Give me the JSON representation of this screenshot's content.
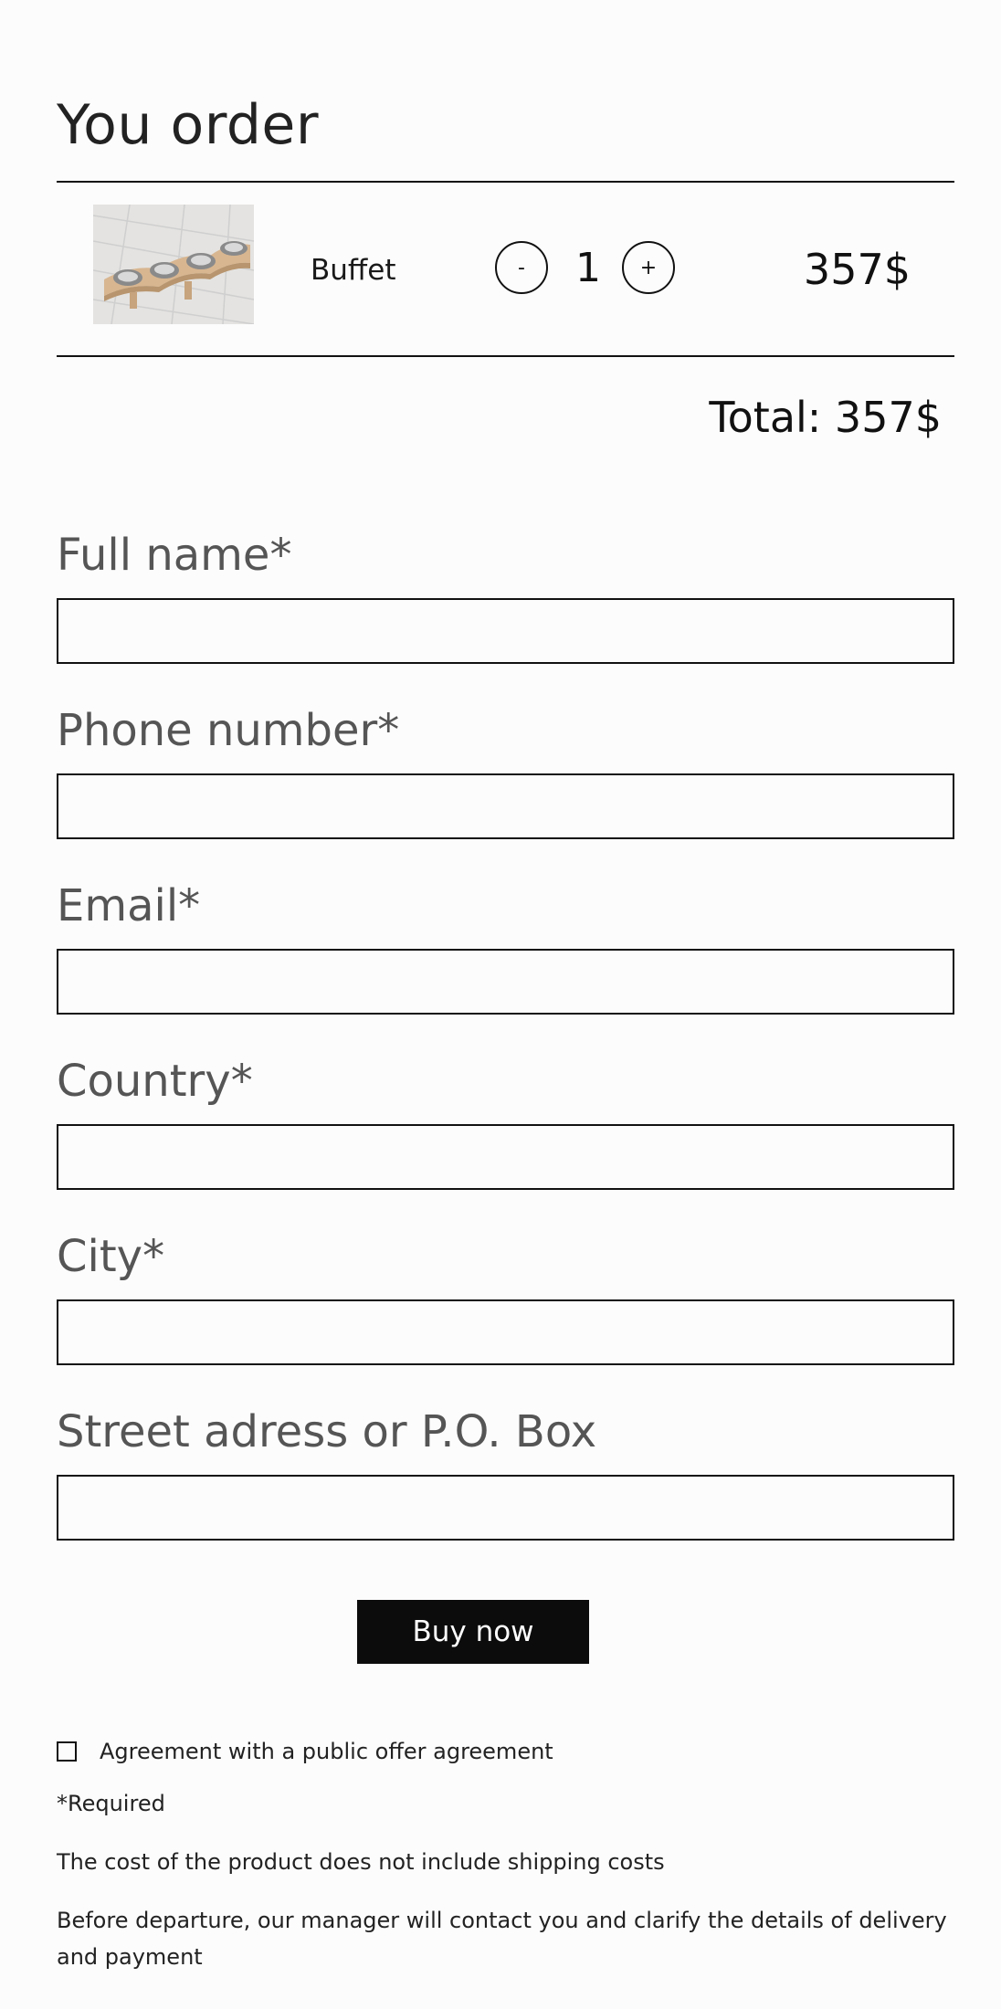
{
  "page": {
    "title": "You order"
  },
  "cart": {
    "item": {
      "image_alt": "wooden feeder with four metal bowls",
      "name": "Buffet",
      "decrement_label": "-",
      "quantity": "1",
      "increment_label": "+",
      "price": "357$"
    },
    "total": "Total: 357$"
  },
  "form": {
    "fields": [
      {
        "label": "Full name*",
        "value": ""
      },
      {
        "label": "Phone number*",
        "value": ""
      },
      {
        "label": "Email*",
        "value": ""
      },
      {
        "label": "Country*",
        "value": ""
      },
      {
        "label": "City*",
        "value": ""
      },
      {
        "label": "Street adress or P.O. Box",
        "value": ""
      }
    ],
    "submit_label": "Buy now",
    "agreement_label": "Agreement with a public offer agreement",
    "agreement_checked": false
  },
  "notes": {
    "required": "*Required",
    "shipping": "The cost of the product does not include shipping costs",
    "contact": "Before departure, our manager will contact you and clarify the details of delivery and payment"
  },
  "colors": {
    "background": "#fcfcfc",
    "text": "#111111",
    "label": "#555555",
    "button": "#0c0c0c",
    "button_text": "#ffffff"
  }
}
